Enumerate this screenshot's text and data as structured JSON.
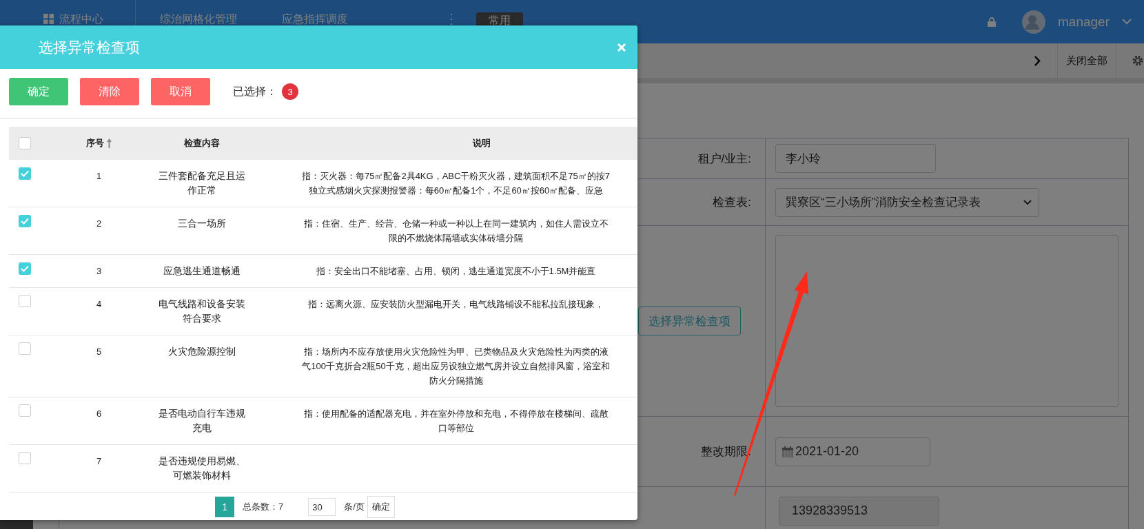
{
  "nav": {
    "items": [
      {
        "kind": "home",
        "label": "流程中心"
      },
      {
        "kind": "link",
        "label": "综治网格化管理"
      },
      {
        "kind": "link",
        "label": "应急指挥调度"
      },
      {
        "kind": "more",
        "label": "⋮"
      },
      {
        "kind": "pill",
        "label": "常用"
      }
    ],
    "user": {
      "name": "manager"
    }
  },
  "tabbar": {
    "close_all": "关闭全部"
  },
  "form": {
    "rows": [
      {
        "kind": "input",
        "label": "租户/业主:",
        "value": "李小玲"
      },
      {
        "kind": "select",
        "label": "检查表:",
        "value": "巽寮区“三小场所”消防安全检查记录表"
      },
      {
        "kind": "textarea",
        "button": "选择异常检查项"
      },
      {
        "kind": "date",
        "label": "整改期限:",
        "value": "2021-01-20"
      },
      {
        "kind": "readonly",
        "value": "13928339513"
      }
    ]
  },
  "modal": {
    "title": "选择异常检查项",
    "buttons": [
      {
        "kind": "confirm",
        "label": "确定"
      },
      {
        "kind": "danger",
        "label": "清除"
      },
      {
        "kind": "danger",
        "label": "取消"
      }
    ],
    "selected_label": "已选择：",
    "selected_count": "3",
    "all_checked": false,
    "columns": [
      {
        "label": "序号",
        "sort_ascending": true
      },
      {
        "label": "检查内容"
      },
      {
        "label": "说明"
      }
    ],
    "rows": [
      {
        "checked": true,
        "no": "1",
        "content": "三件套配备充足且运作正常",
        "desc": [
          "指：灭火器：每75㎡配备2具4KG，ABC干粉灭火器，建筑面积不足75㎡的按7",
          "独立式感烟火灾探测报警器：每60㎡配备1个，不足60㎡按60㎡配备、应急"
        ]
      },
      {
        "checked": true,
        "no": "2",
        "content": "三合一场所",
        "desc": [
          "指：住宿、生产、经营、仓储一种或一种以上在同一建筑内，如住人需设立不",
          "限的不燃烧体隔墙或实体砖墙分隔"
        ]
      },
      {
        "checked": true,
        "no": "3",
        "content": "应急逃生通道畅通",
        "desc": [
          "指：安全出口不能堵塞、占用、锁闭，逃生通道宽度不小于1.5M并能直"
        ]
      },
      {
        "checked": false,
        "no": "4",
        "content": "电气线路和设备安装符合要求",
        "desc": [
          "指：远离火源、应安装防火型漏电开关，电气线路铺设不能私拉乱接现象，"
        ]
      },
      {
        "checked": false,
        "no": "5",
        "content": "火灾危险源控制",
        "desc": [
          "指：场所内不应存放使用火灾危险性为甲、已类物品及火灾危险性为丙类的液",
          "气100千克折合2瓶50千克，超出应另设独立燃气房并设立自然排风窗，浴室和",
          "防火分隔措施"
        ]
      },
      {
        "checked": false,
        "no": "6",
        "content": "是否电动自行车违规充电",
        "desc": [
          "指：使用配备的适配器充电，并在室外停放和充电，不得停放在楼梯间、疏散",
          "口等部位"
        ]
      },
      {
        "checked": false,
        "no": "7",
        "content": "是否违规使用易燃、可燃装饰材料"
      }
    ],
    "pagination": {
      "pages": [
        {
          "label": "1",
          "selected": true
        }
      ],
      "total": "总条数：7",
      "page_size": "30",
      "per_page": "条/页",
      "go": "确定"
    }
  },
  "annotation": {
    "kind": "arrow"
  }
}
